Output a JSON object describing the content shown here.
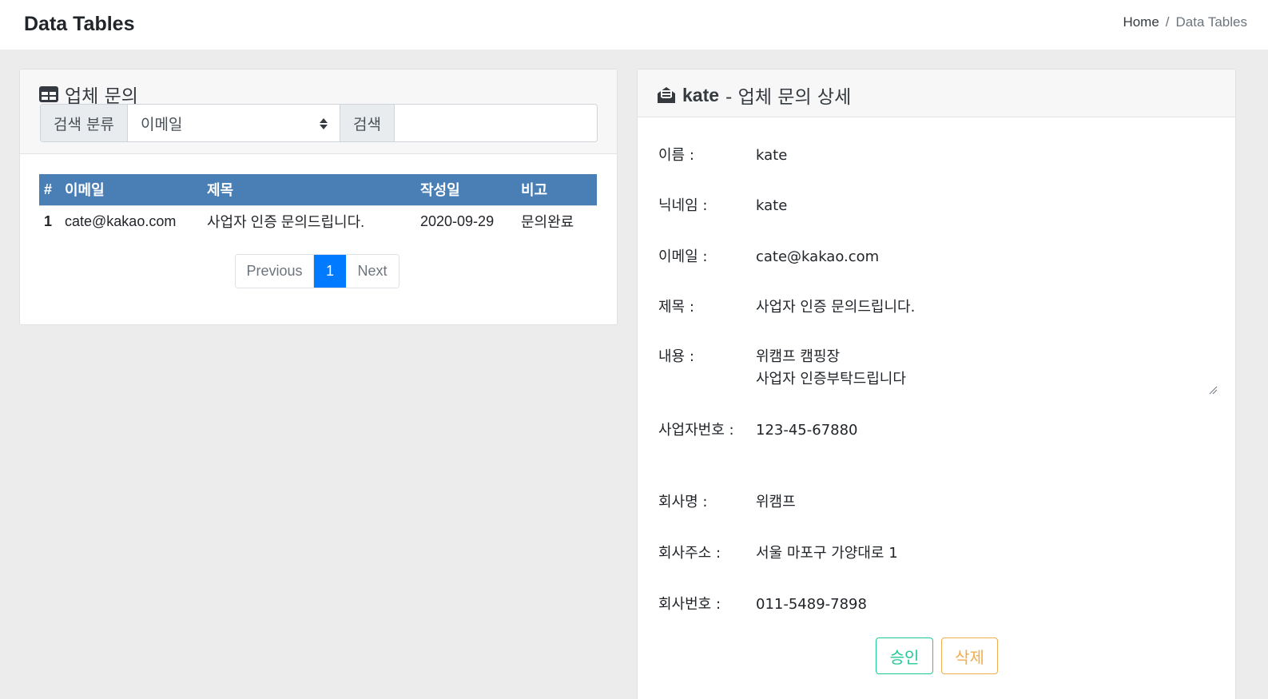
{
  "header": {
    "title": "Data Tables",
    "breadcrumb": {
      "home": "Home",
      "separator": "/",
      "current": "Data Tables"
    }
  },
  "list_card": {
    "title": "업체 문의",
    "search": {
      "category_label": "검색 분류",
      "category_value": "이메일",
      "search_label": "검색",
      "search_value": ""
    },
    "table": {
      "columns": [
        "#",
        "이메일",
        "제목",
        "작성일",
        "비고"
      ],
      "rows": [
        {
          "num": "1",
          "email": "cate@kakao.com",
          "subject": "사업자 인증 문의드립니다.",
          "date": "2020-09-29",
          "note": "문의완료"
        }
      ]
    },
    "pagination": {
      "previous": "Previous",
      "current_page": "1",
      "next": "Next"
    }
  },
  "detail_card": {
    "title_name": "kate",
    "title_suffix": "- 업체 문의 상세",
    "fields": {
      "name": {
        "label": "이름 :",
        "value": "kate"
      },
      "nickname": {
        "label": "닉네임 :",
        "value": "kate"
      },
      "email": {
        "label": "이메일 :",
        "value": "cate@kakao.com"
      },
      "subject": {
        "label": "제목 :",
        "value": "사업자 인증 문의드립니다."
      },
      "content": {
        "label": "내용 :",
        "value": "위캠프 캠핑장\n사업자 인증부탁드립니다"
      },
      "business_number": {
        "label": "사업자번호 :",
        "value": "123-45-67880"
      },
      "company_name": {
        "label": "회사명 :",
        "value": "위캠프"
      },
      "company_address": {
        "label": "회사주소 :",
        "value": "서울 마포구 가양대로 1"
      },
      "company_phone": {
        "label": "회사번호 :",
        "value": "011-5489-7898"
      }
    },
    "buttons": {
      "approve": "승인",
      "delete": "삭제"
    }
  },
  "colors": {
    "table_header": "#4a7fb5",
    "active_page": "#007bff",
    "approve": "#20c997",
    "delete": "#f0ad4e"
  }
}
